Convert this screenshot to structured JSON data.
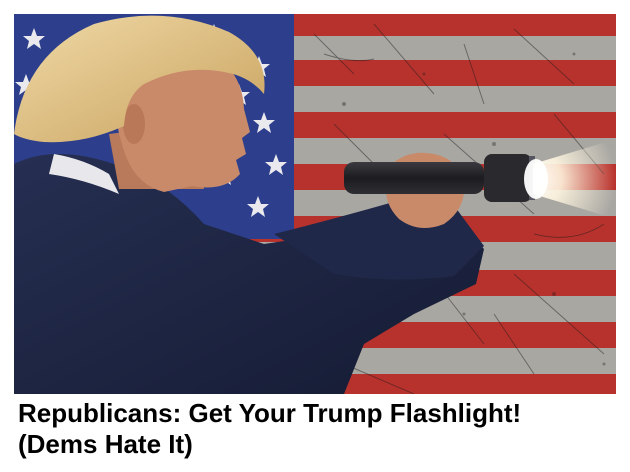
{
  "ad": {
    "headline_line1": "Republicans: Get Your Trump Flashlight!",
    "headline_line2": "(Dems Hate It)"
  },
  "image": {
    "icons": [
      "american-flag-background",
      "man-in-suit-figure",
      "flashlight-icon",
      "light-beam"
    ],
    "colors": {
      "flag_red": "#b8322d",
      "flag_stripe_light": "#a9a7a2",
      "flag_blue": "#2d3f8c",
      "suit_navy": "#1b2340",
      "hair_blond": "#d9b675",
      "skin": "#c98a6a",
      "flashlight": "#2a2a2e",
      "beam": "#fff6e0"
    }
  }
}
